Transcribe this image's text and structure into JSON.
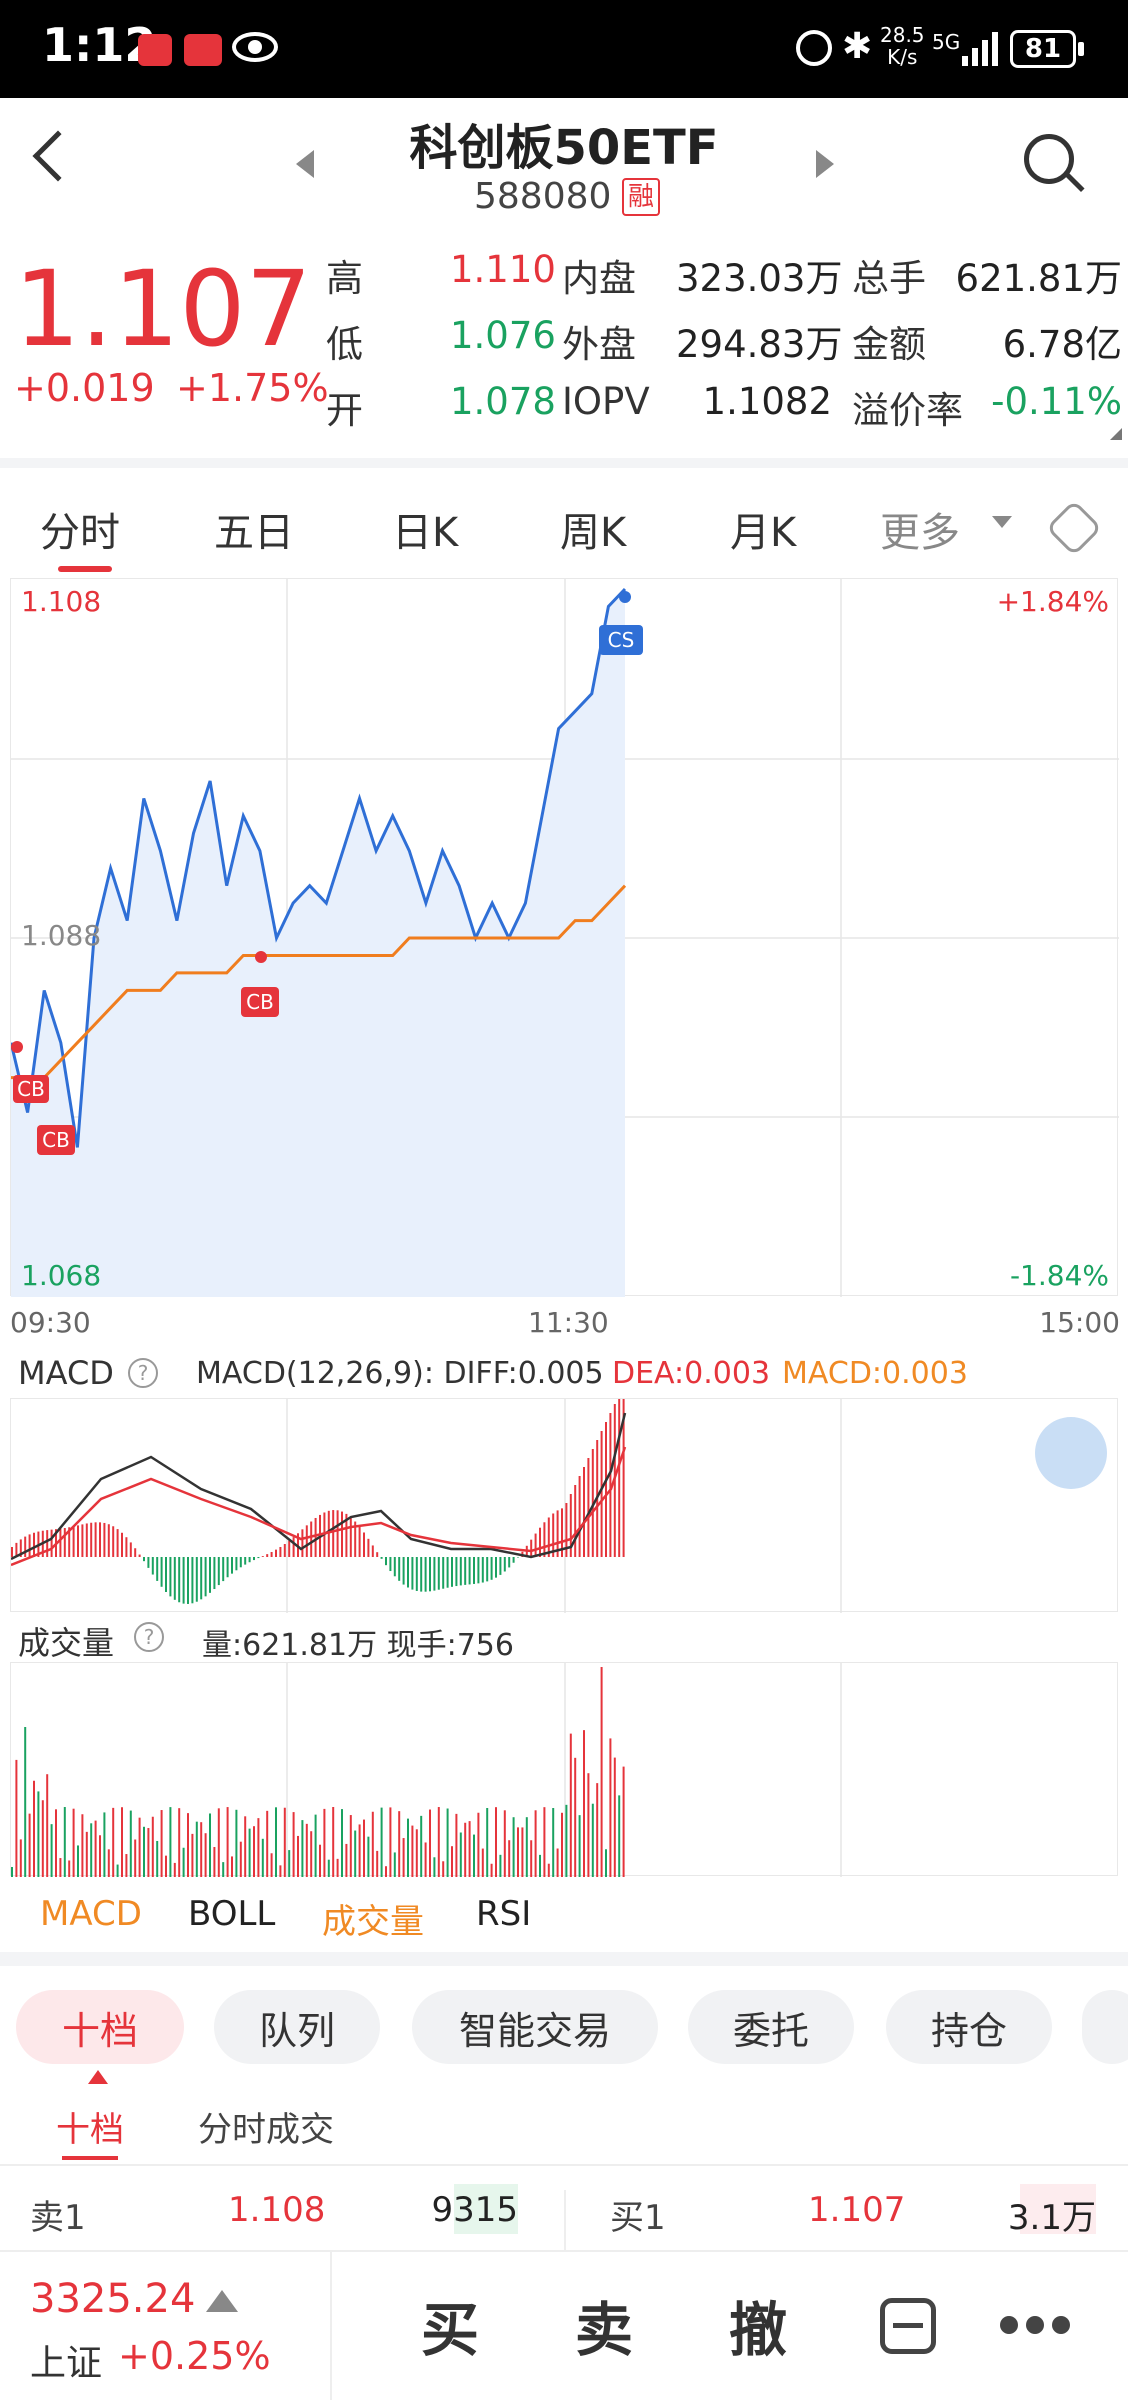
{
  "status": {
    "time": "1:12",
    "speed": "28.5",
    "speed_unit": "K/s",
    "net": "5G",
    "battery": "81"
  },
  "header": {
    "title": "科创板50ETF",
    "code": "588080",
    "tag": "融"
  },
  "quote": {
    "price": "1.107",
    "change": "+0.019",
    "change_pct": "+1.75%",
    "rows": [
      {
        "l1": "高",
        "v1": "1.110",
        "l2": "内盘",
        "v2": "323.03万",
        "l3": "总手",
        "v3": "621.81万"
      },
      {
        "l1": "低",
        "v1": "1.076",
        "l2": "外盘",
        "v2": "294.83万",
        "l3": "金额",
        "v3": "6.78亿"
      },
      {
        "l1": "开",
        "v1": "1.078",
        "l2": "IOPV",
        "v2": "1.1082",
        "l3": "溢价率",
        "v3": "-0.11%"
      }
    ]
  },
  "tabs": [
    "分时",
    "五日",
    "日K",
    "周K",
    "月K",
    "更多"
  ],
  "intraday": {
    "y_top": "1.108",
    "y_mid": "1.088",
    "y_bot": "1.068",
    "pct_top": "+1.84%",
    "pct_bot": "-1.84%",
    "t_start": "09:30",
    "t_mid": "11:30",
    "t_end": "15:00",
    "marker_cb": "CB",
    "marker_cs": "CS"
  },
  "macd": {
    "label": "MACD",
    "params": "MACD(12,26,9): DIFF:0.005",
    "dea": "DEA:0.003",
    "macd": "MACD:0.003"
  },
  "volume": {
    "label": "成交量",
    "info": "量:621.81万 现手:756"
  },
  "indicator_tabs": [
    "MACD",
    "BOLL",
    "成交量",
    "RSI"
  ],
  "bottom_tabs": [
    "十档",
    "队列",
    "智能交易",
    "委托",
    "持仓"
  ],
  "sub_tabs": [
    "十档",
    "分时成交"
  ],
  "orderbook": {
    "sell_label": "卖1",
    "sell_price": "1.108",
    "sell_vol": "9315",
    "buy_label": "买1",
    "buy_price": "1.107",
    "buy_vol": "3.1万"
  },
  "index": {
    "value": "3325.24",
    "name": "上证",
    "pct": "+0.25%"
  },
  "actions": [
    "买",
    "卖",
    "撤"
  ],
  "colors": {
    "up": "#e5343b",
    "down": "#1aa260",
    "price_line": "#2f6fd6",
    "avg_line": "#f07d1e",
    "area": "#e8f0fc"
  },
  "chart_data": {
    "type": "line",
    "x": [
      "09:30",
      "11:30",
      "15:00"
    ],
    "ylim": [
      1.068,
      1.108
    ],
    "series": [
      {
        "values": [
          1.082,
          1.078,
          1.085,
          1.082,
          1.076,
          1.088,
          1.092,
          1.089,
          1.096,
          1.093,
          1.089,
          1.094,
          1.097,
          1.091,
          1.095,
          1.093,
          1.088,
          1.09,
          1.091,
          1.09,
          1.093,
          1.096,
          1.093,
          1.095,
          1.093,
          1.09,
          1.093,
          1.091,
          1.088,
          1.09,
          1.088,
          1.09,
          1.095,
          1.1,
          1.101,
          1.102,
          1.107,
          1.108
        ]
      },
      {
        "values": [
          1.08,
          1.08,
          1.08,
          1.081,
          1.082,
          1.083,
          1.084,
          1.085,
          1.085,
          1.085,
          1.086,
          1.086,
          1.086,
          1.086,
          1.087,
          1.087,
          1.087,
          1.087,
          1.087,
          1.087,
          1.087,
          1.087,
          1.087,
          1.087,
          1.088,
          1.088,
          1.088,
          1.088,
          1.088,
          1.088,
          1.088,
          1.088,
          1.088,
          1.088,
          1.089,
          1.089,
          1.09,
          1.091
        ]
      }
    ]
  }
}
